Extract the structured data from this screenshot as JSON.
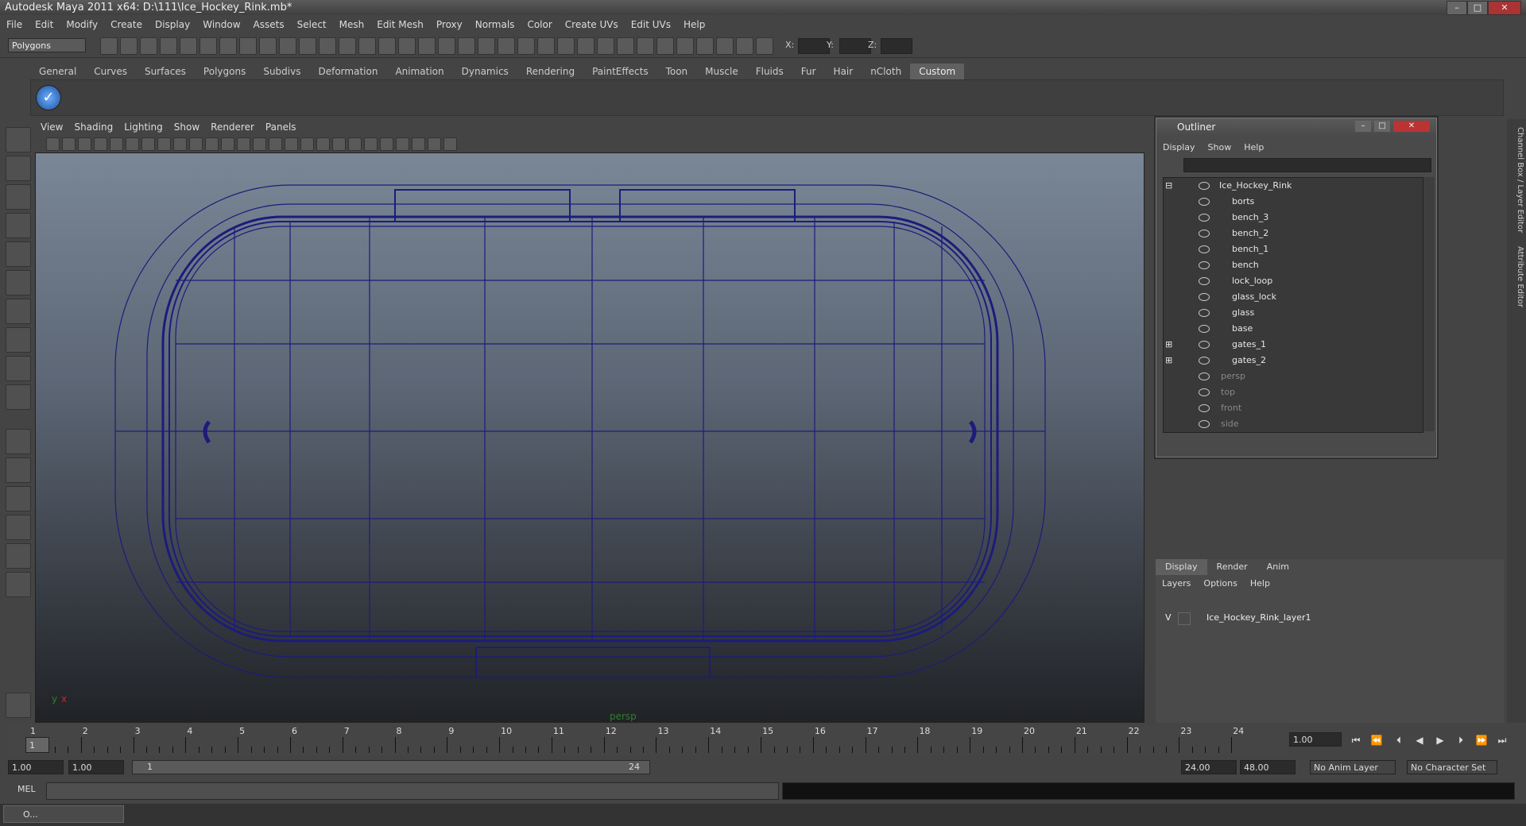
{
  "window": {
    "title": "Autodesk Maya 2011 x64: D:\\111\\Ice_Hockey_Rink.mb*",
    "min": "–",
    "max": "□",
    "close": "✕"
  },
  "menubar": [
    "File",
    "Edit",
    "Modify",
    "Create",
    "Display",
    "Window",
    "Assets",
    "Select",
    "Mesh",
    "Edit Mesh",
    "Proxy",
    "Normals",
    "Color",
    "Create UVs",
    "Edit UVs",
    "Help"
  ],
  "statusline": {
    "mode": "Polygons",
    "x_label": "X:",
    "y_label": "Y:",
    "z_label": "Z:"
  },
  "shelf_tabs": [
    "General",
    "Curves",
    "Surfaces",
    "Polygons",
    "Subdivs",
    "Deformation",
    "Animation",
    "Dynamics",
    "Rendering",
    "PaintEffects",
    "Toon",
    "Muscle",
    "Fluids",
    "Fur",
    "Hair",
    "nCloth",
    "Custom"
  ],
  "shelf_active": "Custom",
  "panel_menu": [
    "View",
    "Shading",
    "Lighting",
    "Show",
    "Renderer",
    "Panels"
  ],
  "viewport": {
    "camera_label": "persp",
    "axis_y": "y",
    "axis_x": "x"
  },
  "outliner": {
    "title": "Outliner",
    "menu": [
      "Display",
      "Show",
      "Help"
    ],
    "items": [
      {
        "label": "Ice_Hockey_Rink",
        "depth": 0,
        "expandable": true,
        "dim": false
      },
      {
        "label": "borts",
        "depth": 1,
        "expandable": false,
        "dim": false
      },
      {
        "label": "bench_3",
        "depth": 1,
        "expandable": false,
        "dim": false
      },
      {
        "label": "bench_2",
        "depth": 1,
        "expandable": false,
        "dim": false
      },
      {
        "label": "bench_1",
        "depth": 1,
        "expandable": false,
        "dim": false
      },
      {
        "label": "bench",
        "depth": 1,
        "expandable": false,
        "dim": false
      },
      {
        "label": "lock_loop",
        "depth": 1,
        "expandable": false,
        "dim": false
      },
      {
        "label": "glass_lock",
        "depth": 1,
        "expandable": false,
        "dim": false
      },
      {
        "label": "glass",
        "depth": 1,
        "expandable": false,
        "dim": false
      },
      {
        "label": "base",
        "depth": 1,
        "expandable": false,
        "dim": false
      },
      {
        "label": "gates_1",
        "depth": 1,
        "expandable": true,
        "dim": false
      },
      {
        "label": "gates_2",
        "depth": 1,
        "expandable": true,
        "dim": false
      },
      {
        "label": "persp",
        "depth": 0,
        "expandable": false,
        "dim": true
      },
      {
        "label": "top",
        "depth": 0,
        "expandable": false,
        "dim": true
      },
      {
        "label": "front",
        "depth": 0,
        "expandable": false,
        "dim": true
      },
      {
        "label": "side",
        "depth": 0,
        "expandable": false,
        "dim": true
      }
    ]
  },
  "layers": {
    "tabs": [
      "Display",
      "Render",
      "Anim"
    ],
    "menu": [
      "Layers",
      "Options",
      "Help"
    ],
    "layer_visible": "V",
    "layer_name": "Ice_Hockey_Rink_layer1"
  },
  "side_tabs": [
    "Channel Box / Layer Editor",
    "Attribute Editor"
  ],
  "timeline": {
    "ticks": [
      "1",
      "2",
      "3",
      "4",
      "5",
      "6",
      "7",
      "8",
      "9",
      "10",
      "11",
      "12",
      "13",
      "14",
      "15",
      "16",
      "17",
      "18",
      "19",
      "20",
      "21",
      "22",
      "23",
      "24"
    ],
    "current_frame_marker": "1",
    "current_time": "1.00"
  },
  "range": {
    "start": "1.00",
    "playback_start": "1.00",
    "slider_start": "1",
    "slider_end": "24",
    "playback_end": "24.00",
    "end": "48.00",
    "anim_layer": "No Anim Layer",
    "char_set": "No Character Set"
  },
  "cmdline": {
    "label": "MEL"
  },
  "taskbar": {
    "item": "O..."
  },
  "colors": {
    "wire": "#1c1c7a",
    "accent": "#2e7d32"
  }
}
